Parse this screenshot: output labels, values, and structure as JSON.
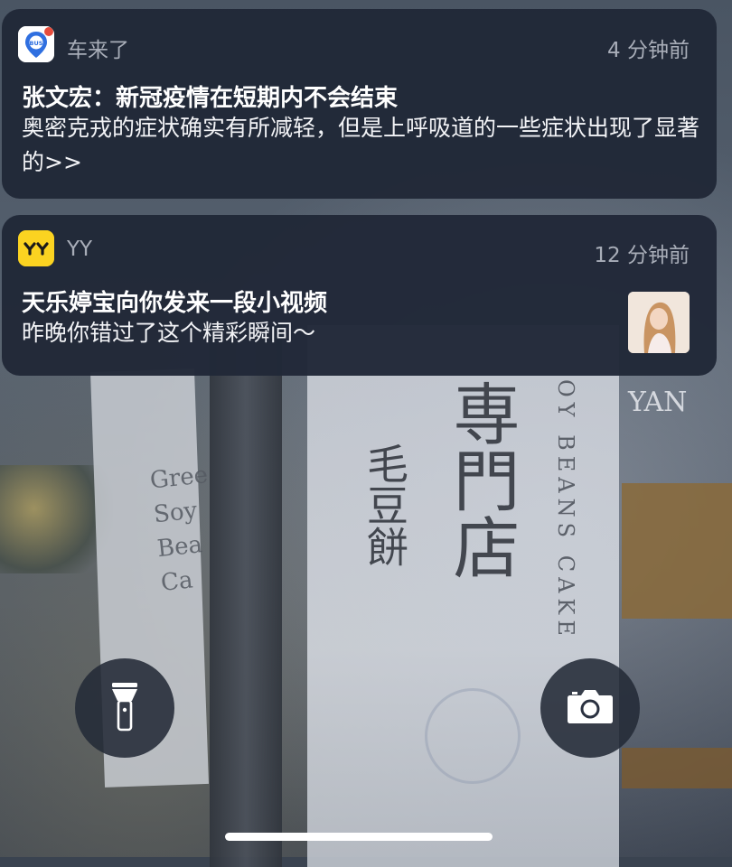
{
  "notifications": [
    {
      "app_name": "车来了",
      "icon": "bus-app-icon",
      "icon_text": "BUS",
      "time": "4 分钟前",
      "title": "张文宏：新冠疫情在短期内不会结束",
      "body": "奥密克戎的症状确实有所减轻，但是上呼吸道的一些症状出现了显著的>>"
    },
    {
      "app_name": "YY",
      "icon": "yy-app-icon",
      "time": "12 分钟前",
      "title": "天乐婷宝向你发来一段小视频",
      "body": "昨晚你错过了这个精彩瞬间～",
      "thumbnail": "video-thumbnail"
    }
  ],
  "controls": {
    "flashlight": "flashlight-icon",
    "camera": "camera-icon"
  },
  "colors": {
    "notification_bg": "#212838",
    "yy_yellow": "#fbd321",
    "bus_blue": "#2f6fe0"
  }
}
